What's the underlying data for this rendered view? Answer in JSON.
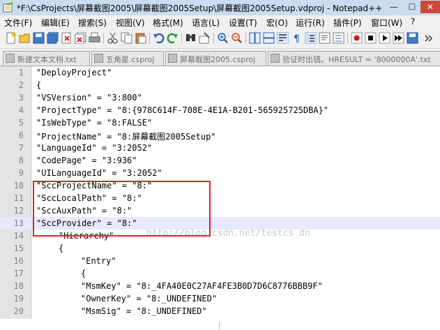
{
  "window": {
    "title": "*F:\\CsProjects\\屏幕截图2005\\屏幕截图2005Setup\\屏幕截图2005Setup.vdproj - Notepad++",
    "minimize": "—",
    "maximize": "☐",
    "close": "✕"
  },
  "menu": [
    "文件(F)",
    "编辑(E)",
    "搜索(S)",
    "视图(V)",
    "格式(M)",
    "语言(L)",
    "设置(T)",
    "宏(O)",
    "运行(R)",
    "插件(P)",
    "窗口(W)",
    "?"
  ],
  "tabs": [
    {
      "label": "新建文本文档.txt"
    },
    {
      "label": "五角星.csproj"
    },
    {
      "label": "屏幕截图2005.csproj"
    },
    {
      "label": "验证时出错。HRESULT = '8000000A'.txt"
    }
  ],
  "lines": [
    {
      "n": "1",
      "text": "\"DeployProject\""
    },
    {
      "n": "2",
      "text": "{"
    },
    {
      "n": "3",
      "text": "\"VSVersion\" = \"3:800\""
    },
    {
      "n": "4",
      "text": "\"ProjectType\" = \"8:{978C614F-708E-4E1A-B201-565925725DBA}\""
    },
    {
      "n": "5",
      "text": "\"IsWebType\" = \"8:FALSE\""
    },
    {
      "n": "6",
      "text": "\"ProjectName\" = \"8:屏幕截图2005Setup\""
    },
    {
      "n": "7",
      "text": "\"LanguageId\" = \"3:2052\""
    },
    {
      "n": "8",
      "text": "\"CodePage\" = \"3:936\""
    },
    {
      "n": "9",
      "text": "\"UILanguageId\" = \"3:2052\""
    },
    {
      "n": "10",
      "text": "\"SccProjectName\" = \"8:\""
    },
    {
      "n": "11",
      "text": "\"SccLocalPath\" = \"8:\""
    },
    {
      "n": "12",
      "text": "\"SccAuxPath\" = \"8:\""
    },
    {
      "n": "13",
      "text": "\"SccProvider\" = \"8:\""
    },
    {
      "n": "14",
      "text": "\"Hierarchy\""
    },
    {
      "n": "15",
      "text": "{"
    },
    {
      "n": "16",
      "text": "\"Entry\""
    },
    {
      "n": "17",
      "text": "{"
    },
    {
      "n": "18",
      "text": "\"MsmKey\" = \"8:_4FA40E0C27AF4FE3B0D7D6C8776BBB9F\""
    },
    {
      "n": "19",
      "text": "\"OwnerKey\" = \"8:_UNDEFINED\""
    },
    {
      "n": "20",
      "text": "\"MsmSig\" = \"8:_UNDEFINED\""
    }
  ],
  "watermark": "http://blog.csdn.net/testcs_dn",
  "colors": {
    "highlight_box": "#e0202c",
    "current_line": "#e8e8ff",
    "accent": "#316ac5"
  }
}
